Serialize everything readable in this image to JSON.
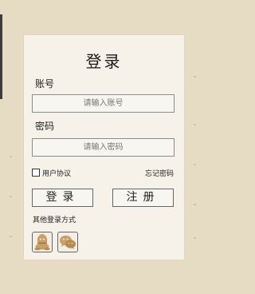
{
  "login_card": {
    "title": "登录",
    "account_label": "账号",
    "account_placeholder": "请输入账号",
    "password_label": "密码",
    "password_placeholder": "请输入密码",
    "agreement_label": "用户协议",
    "forgot_password": "忘记密码",
    "login_button": "登录",
    "register_button": "注册",
    "other_login_label": "其他登录方式"
  },
  "colors": {
    "background": "#e6dcc4",
    "card": "#f6f2ea",
    "icon_tan": "#caa06a"
  },
  "icons": {
    "qq": "qq-icon",
    "wechat": "wechat-icon"
  }
}
